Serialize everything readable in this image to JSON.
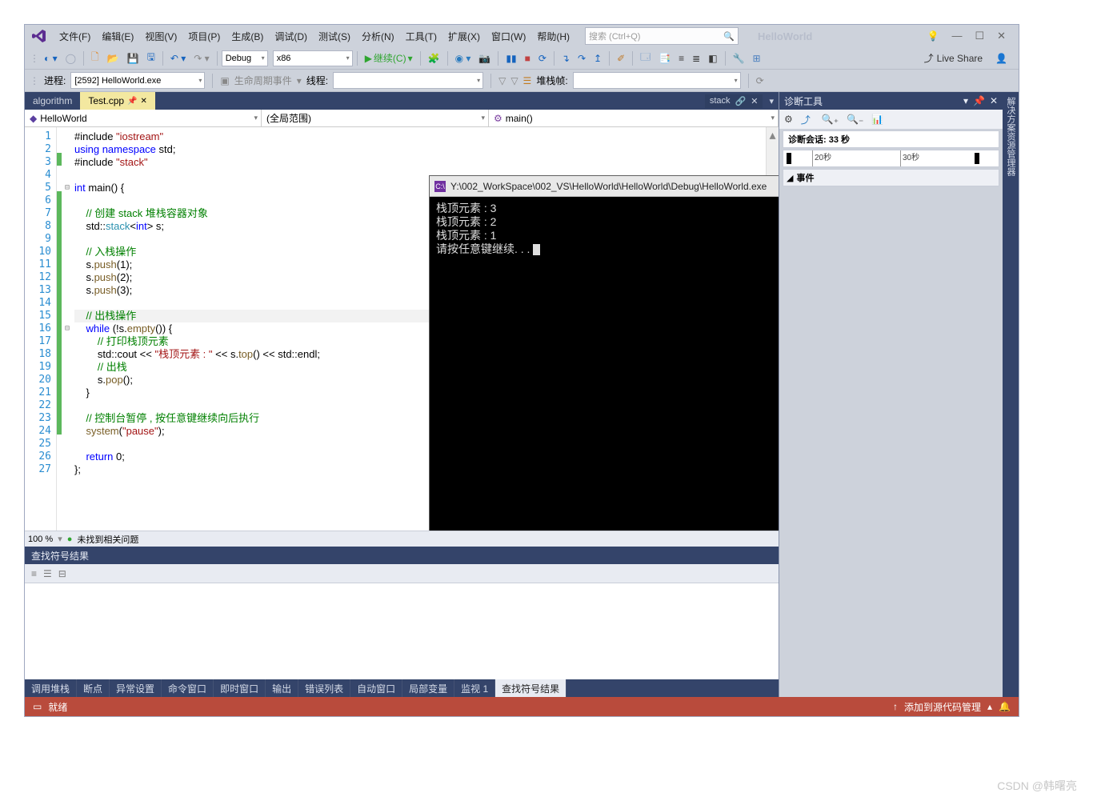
{
  "menu": {
    "file": "文件(F)",
    "edit": "编辑(E)",
    "view": "视图(V)",
    "project": "项目(P)",
    "build": "生成(B)",
    "debug": "调试(D)",
    "test": "测试(S)",
    "analyze": "分析(N)",
    "tools": "工具(T)",
    "extensions": "扩展(X)",
    "window": "窗口(W)",
    "help": "帮助(H)"
  },
  "title": {
    "solution": "HelloWorld",
    "search_placeholder": "搜索 (Ctrl+Q)"
  },
  "toolbar": {
    "config": "Debug",
    "platform": "x86",
    "continue": "继续(C)",
    "live_share": "Live Share"
  },
  "debug": {
    "process_label": "进程:",
    "process_value": "[2592] HelloWorld.exe",
    "lifecycle": "生命周期事件",
    "threads_label": "线程:",
    "stackframe": "堆栈帧:"
  },
  "tabs": {
    "algorithm": "algorithm",
    "current": "Test.cpp",
    "stack": "stack"
  },
  "combos": {
    "project": "HelloWorld",
    "scope": "(全局范围)",
    "func": "main()"
  },
  "zoom": {
    "pct": "100 %",
    "issues": "未找到相关问题"
  },
  "find": {
    "title": "查找符号结果"
  },
  "bottom_tabs": [
    "调用堆栈",
    "断点",
    "异常设置",
    "命令窗口",
    "即时窗口",
    "输出",
    "错误列表",
    "自动窗口",
    "局部变量",
    "监视 1",
    "查找符号结果"
  ],
  "status": {
    "ready": "就绪",
    "add_source": "添加到源代码管理"
  },
  "diag": {
    "title": "诊断工具",
    "session": "诊断会话: 33 秒",
    "tick20": "20秒",
    "tick30": "30秒",
    "events": "事件"
  },
  "side_tab": "解决方案资源管理器",
  "console": {
    "title": "Y:\\002_WorkSpace\\002_VS\\HelloWorld\\HelloWorld\\Debug\\HelloWorld.exe",
    "l1": "栈顶元素 : 3",
    "l2": "栈顶元素 : 2",
    "l3": "栈顶元素 : 1",
    "l4": "请按任意键继续. . . "
  },
  "code": {
    "lines": [
      {
        "n": 1,
        "chg": "",
        "html": "#include <span class='str'>\"iostream\"</span>"
      },
      {
        "n": 2,
        "chg": "",
        "html": "<span class='kw'>using namespace</span> std;"
      },
      {
        "n": 3,
        "chg": "green",
        "fold": "",
        "html": "#include <span class='str'>\"stack\"</span>"
      },
      {
        "n": 4,
        "chg": "",
        "html": ""
      },
      {
        "n": 5,
        "chg": "",
        "fold": "⊟",
        "html": "<span class='kw'>int</span> main() {"
      },
      {
        "n": 6,
        "chg": "green",
        "html": ""
      },
      {
        "n": 7,
        "chg": "green",
        "html": "    <span class='cmt'>// 创建 stack 堆栈容器对象</span>"
      },
      {
        "n": 8,
        "chg": "green",
        "html": "    std::<span class='id2'>stack</span>&lt;<span class='kw'>int</span>&gt; s;"
      },
      {
        "n": 9,
        "chg": "green",
        "html": ""
      },
      {
        "n": 10,
        "chg": "green",
        "html": "    <span class='cmt'>// 入栈操作</span>"
      },
      {
        "n": 11,
        "chg": "green",
        "html": "    s.<span class='func'>push</span>(1);"
      },
      {
        "n": 12,
        "chg": "green",
        "html": "    s.<span class='func'>push</span>(2);"
      },
      {
        "n": 13,
        "chg": "green",
        "html": "    s.<span class='func'>push</span>(3);"
      },
      {
        "n": 14,
        "chg": "green",
        "html": ""
      },
      {
        "n": 15,
        "chg": "green",
        "cursor": true,
        "html": "    <span class='cmt'>// 出栈操作</span>"
      },
      {
        "n": 16,
        "chg": "green",
        "fold": "⊟",
        "html": "    <span class='kw'>while</span> (!s.<span class='func'>empty</span>()) {"
      },
      {
        "n": 17,
        "chg": "green",
        "html": "        <span class='cmt'>// 打印栈顶元素</span>"
      },
      {
        "n": 18,
        "chg": "green",
        "html": "        std::cout &lt;&lt; <span class='str'>\"栈顶元素 : \"</span> &lt;&lt; s.<span class='func'>top</span>() &lt;&lt; std::endl;"
      },
      {
        "n": 19,
        "chg": "green",
        "html": "        <span class='cmt'>// 出栈</span>"
      },
      {
        "n": 20,
        "chg": "green",
        "html": "        s.<span class='func'>pop</span>();"
      },
      {
        "n": 21,
        "chg": "green",
        "html": "    }"
      },
      {
        "n": 22,
        "chg": "green",
        "html": ""
      },
      {
        "n": 23,
        "chg": "green",
        "html": "    <span class='cmt'>// 控制台暂停 , 按任意键继续向后执行</span>"
      },
      {
        "n": 24,
        "chg": "green",
        "html": "    <span class='func'>system</span>(<span class='str'>\"pause\"</span>);"
      },
      {
        "n": 25,
        "chg": "",
        "html": ""
      },
      {
        "n": 26,
        "chg": "",
        "html": "    <span class='kw'>return</span> 0;"
      },
      {
        "n": 27,
        "chg": "",
        "html": "};"
      }
    ]
  },
  "watermark": "CSDN @韩曙亮"
}
